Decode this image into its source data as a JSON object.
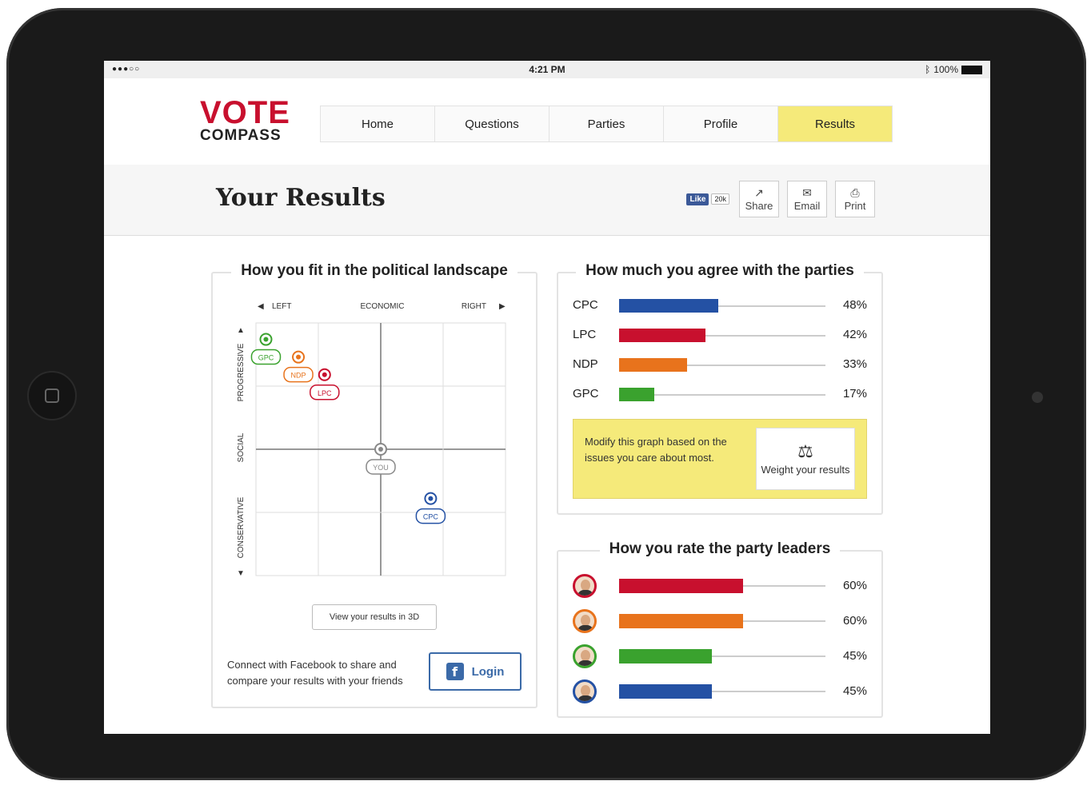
{
  "status": {
    "signal": "●●●○○",
    "time": "4:21 PM",
    "bluetooth": "ᛒ",
    "battery": "100%"
  },
  "logo": {
    "line1": "VOTE",
    "line2": "COMPASS"
  },
  "nav": {
    "tabs": [
      {
        "label": "Home",
        "active": false
      },
      {
        "label": "Questions",
        "active": false
      },
      {
        "label": "Parties",
        "active": false
      },
      {
        "label": "Profile",
        "active": false
      },
      {
        "label": "Results",
        "active": true
      }
    ]
  },
  "page_title": "Your Results",
  "social": {
    "like_label": "Like",
    "like_count": "20k",
    "share": "Share",
    "email": "Email",
    "print": "Print"
  },
  "landscape": {
    "title": "How you fit in the political landscape",
    "x_left": "LEFT",
    "x_center": "ECONOMIC",
    "x_right": "RIGHT",
    "y_top": "PROGRESSIVE",
    "y_center": "SOCIAL",
    "y_bottom": "CONSERVATIVE",
    "view3d": "View your results in 3D",
    "fb_text": "Connect with Facebook to share and compare your results with your friends",
    "login": "Login"
  },
  "chart_data": {
    "type": "scatter",
    "xlabel": "ECONOMIC",
    "ylabel": "SOCIAL",
    "xlim": [
      -1,
      1
    ],
    "ylim": [
      -1,
      1
    ],
    "grid": true,
    "points": [
      {
        "label": "GPC",
        "x": -0.92,
        "y": 0.87,
        "color": "#3aa22e"
      },
      {
        "label": "NDP",
        "x": -0.66,
        "y": 0.73,
        "color": "#e8731c"
      },
      {
        "label": "LPC",
        "x": -0.45,
        "y": 0.59,
        "color": "#c8102e"
      },
      {
        "label": "YOU",
        "x": 0.0,
        "y": 0.0,
        "color": "#888888"
      },
      {
        "label": "CPC",
        "x": 0.4,
        "y": -0.39,
        "color": "#2451a4"
      }
    ]
  },
  "agree": {
    "title": "How much you agree with the parties",
    "parties": [
      {
        "label": "CPC",
        "value": 48,
        "pct": "48%",
        "color": "#2451a4"
      },
      {
        "label": "LPC",
        "value": 42,
        "pct": "42%",
        "color": "#c8102e"
      },
      {
        "label": "NDP",
        "value": 33,
        "pct": "33%",
        "color": "#e8731c"
      },
      {
        "label": "GPC",
        "value": 17,
        "pct": "17%",
        "color": "#3aa22e"
      }
    ],
    "weight_text": "Modify this graph based on the issues you care about most.",
    "weight_button": "Weight your results"
  },
  "leaders": {
    "title": "How you rate the party leaders",
    "rows": [
      {
        "value": 60,
        "pct": "60%",
        "color": "#c8102e"
      },
      {
        "value": 60,
        "pct": "60%",
        "color": "#e8731c"
      },
      {
        "value": 45,
        "pct": "45%",
        "color": "#3aa22e"
      },
      {
        "value": 45,
        "pct": "45%",
        "color": "#2451a4"
      }
    ]
  }
}
